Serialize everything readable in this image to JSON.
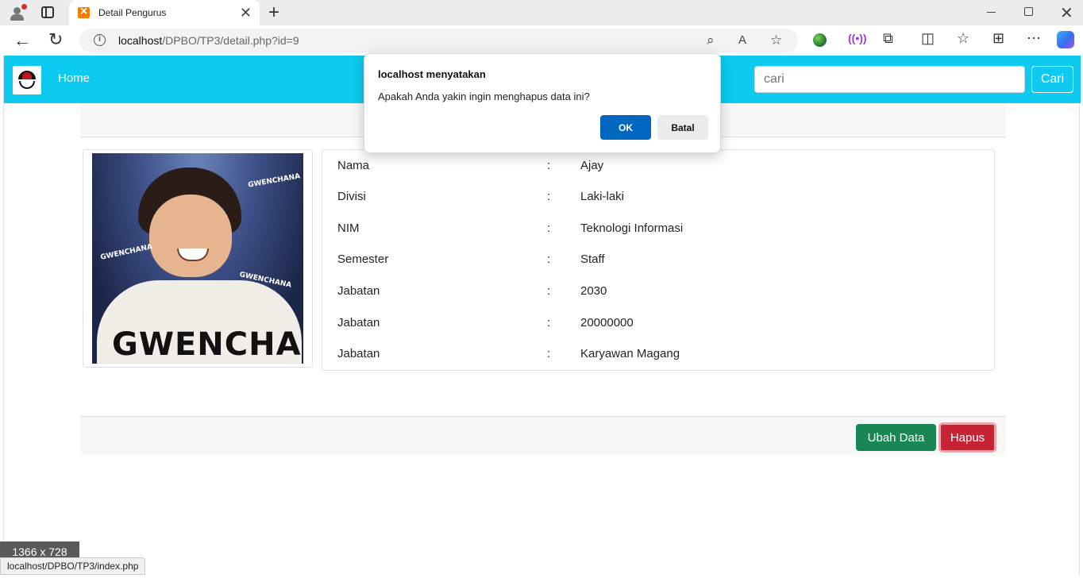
{
  "browser": {
    "tab_title": "Detail Pengurus",
    "url_host": "localhost",
    "url_path": "/DPBO/TP3/detail.php?id=9"
  },
  "navbar": {
    "home_label": "Home",
    "search_placeholder": "cari",
    "search_button": "Cari"
  },
  "details": [
    {
      "label": "Nama",
      "value": "Ajay"
    },
    {
      "label": "Divisi",
      "value": "Laki-laki"
    },
    {
      "label": "NIM",
      "value": "Teknologi Informasi"
    },
    {
      "label": "Semester",
      "value": "Staff"
    },
    {
      "label": "Jabatan",
      "value": "2030"
    },
    {
      "label": "Jabatan",
      "value": "20000000"
    },
    {
      "label": "Jabatan",
      "value": "Karyawan Magang"
    }
  ],
  "colon": ":",
  "photo": {
    "caption_big": "GWENCHANA",
    "caption_small": "GWENCHANA"
  },
  "footer": {
    "edit_label": "Ubah Data",
    "delete_label": "Hapus"
  },
  "dialog": {
    "title": "localhost menyatakan",
    "message": "Apakah Anda yakin ingin menghapus data ini?",
    "ok_label": "OK",
    "cancel_label": "Batal"
  },
  "status": {
    "viewport_size": "1366 x 728",
    "hover_url": "localhost/DPBO/TP3/index.php"
  },
  "colors": {
    "navbar": "#0dcaf0",
    "success": "#198754",
    "danger": "#c82333",
    "dialog_ok": "#0067c0"
  }
}
